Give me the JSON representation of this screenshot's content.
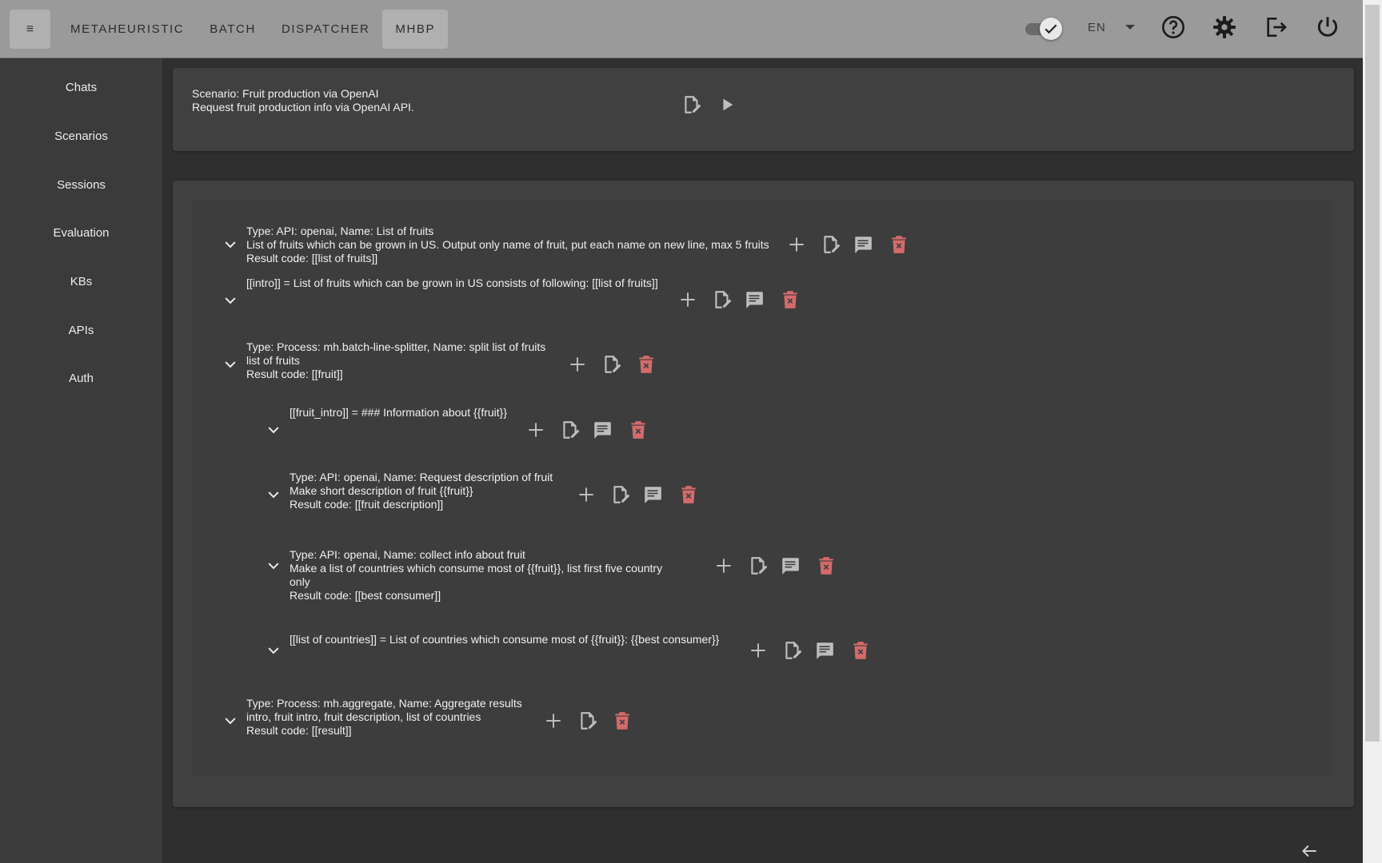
{
  "topbar": {
    "menu_icon": "hamburger-icon",
    "nav": [
      "METAHEURISTIC",
      "BATCH",
      "DISPATCHER",
      "MHBP"
    ],
    "active_nav": "MHBP",
    "language": "EN",
    "icons": [
      "toggle-check-icon",
      "help-icon",
      "settings-icon",
      "logout-icon",
      "power-icon"
    ]
  },
  "sidebar": {
    "items": [
      "Chats",
      "Scenarios",
      "Sessions",
      "Evaluation",
      "KBs",
      "APIs",
      "Auth"
    ]
  },
  "scenario": {
    "title": "Scenario: Fruit production via OpenAI",
    "description": "Request fruit production info via OpenAI API."
  },
  "steps": [
    {
      "lines": [
        "Type: API: openai, Name: List of fruits",
        "List of fruits which can be grown in US. Output only name of fruit, put each name on new line, max 5 fruits",
        "Result code: [[list of fruits]]"
      ],
      "has_comment": true
    },
    {
      "lines": [
        "[[intro]] = List of fruits which can be grown in US consists of following: [[list of fruits]]"
      ],
      "has_comment": true
    },
    {
      "lines": [
        "Type: Process: mh.batch-line-splitter, Name: split list of fruits",
        "list of fruits",
        "Result code: [[fruit]]"
      ],
      "has_comment": false
    },
    {
      "lines": [
        "[[fruit_intro]] = ### Information about {{fruit}}"
      ],
      "has_comment": true
    },
    {
      "lines": [
        "Type: API: openai, Name: Request description of fruit",
        "Make short description of fruit {{fruit}}",
        "Result code: [[fruit description]]"
      ],
      "has_comment": true
    },
    {
      "lines": [
        "Type: API: openai, Name: collect info about fruit",
        "Make a list of countries which consume most of {{fruit}}, list first five country",
        "only",
        "Result code: [[best consumer]]"
      ],
      "has_comment": true
    },
    {
      "lines": [
        "[[list of countries]] = List of countries which consume most of {{fruit}}: {{best consumer}}"
      ],
      "has_comment": true
    },
    {
      "lines": [
        "Type: Process: mh.aggregate, Name: Aggregate results",
        "intro, fruit intro, fruit description, list of countries",
        "Result code: [[result]]"
      ],
      "has_comment": false
    }
  ],
  "colors": {
    "topbar": "#9a9a9a",
    "sidebar": "#3b3b3b",
    "panel": "#404040",
    "delete": "#d46a6a"
  }
}
